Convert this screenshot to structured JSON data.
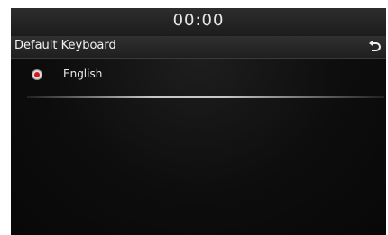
{
  "status_bar": {
    "clock": "00:00"
  },
  "header": {
    "title": "Default Keyboard",
    "back_icon": "return-arrow-icon"
  },
  "keyboard_list": {
    "items": [
      {
        "label": "English",
        "selected": true
      }
    ]
  },
  "colors": {
    "radio_selected": "#d81818",
    "background": "#0a0a0a",
    "text": "#e8e8e8"
  }
}
